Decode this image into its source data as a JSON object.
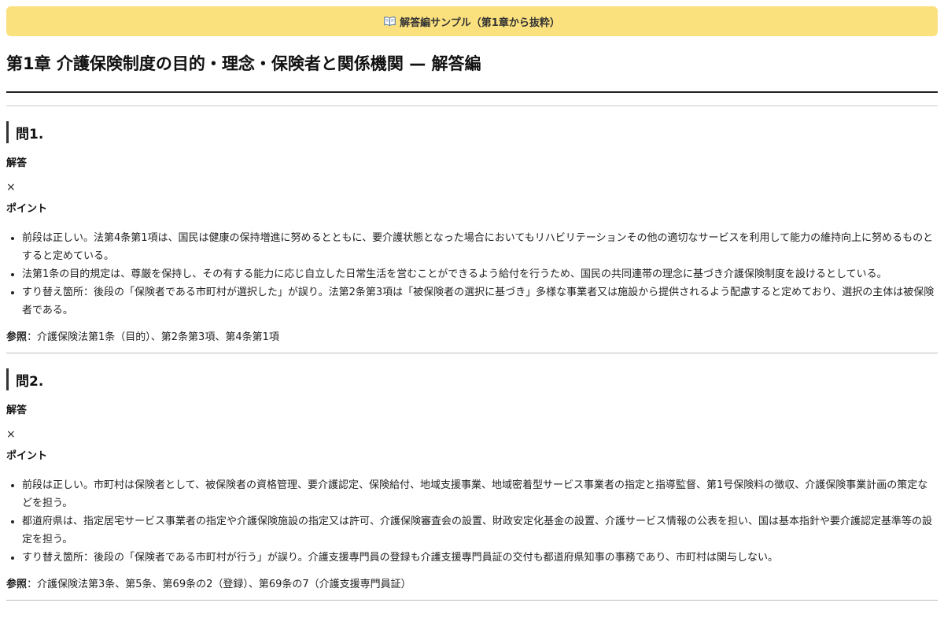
{
  "banner": {
    "text": "解答編サンプル（第1章から抜粋）",
    "icon": "open-book-icon",
    "color": "#fbe17e"
  },
  "chapter": {
    "title": "第1章 介護保険制度の目的・理念・保険者と関係機関 — 解答編"
  },
  "questions": [
    {
      "title": "問1.",
      "answer_label": "解答",
      "answer": "×",
      "points_label": "ポイント",
      "points": [
        "前段は正しい。法第4条第1項は、国民は健康の保持増進に努めるとともに、要介護状態となった場合においてもリハビリテーションその他の適切なサービスを利用して能力の維持向上に努めるものとすると定めている。",
        "法第1条の目的規定は、尊厳を保持し、その有する能力に応じ自立した日常生活を営むことができるよう給付を行うため、国民の共同連帯の理念に基づき介護保険制度を設けるとしている。",
        "すり替え箇所：後段の「保険者である市町村が選択した」が誤り。法第2条第3項は「被保険者の選択に基づき」多様な事業者又は施設から提供されるよう配慮すると定めており、選択の主体は被保険者である。"
      ],
      "ref_label": "参照",
      "ref_text": "：介護保険法第1条（目的）、第2条第3項、第4条第1項"
    },
    {
      "title": "問2.",
      "answer_label": "解答",
      "answer": "×",
      "points_label": "ポイント",
      "points": [
        "前段は正しい。市町村は保険者として、被保険者の資格管理、要介護認定、保険給付、地域支援事業、地域密着型サービス事業者の指定と指導監督、第1号保険料の徴収、介護保険事業計画の策定などを担う。",
        "都道府県は、指定居宅サービス事業者の指定や介護保険施設の指定又は許可、介護保険審査会の設置、財政安定化基金の設置、介護サービス情報の公表を担い、国は基本指針や要介護認定基準等の設定を担う。",
        "すり替え箇所：後段の「保険者である市町村が行う」が誤り。介護支援専門員の登録も介護支援専門員証の交付も都道府県知事の事務であり、市町村は関与しない。"
      ],
      "ref_label": "参照",
      "ref_text": "：介護保険法第3条、第5条、第69条の2（登録）、第69条の7（介護支援専門員証）"
    }
  ]
}
